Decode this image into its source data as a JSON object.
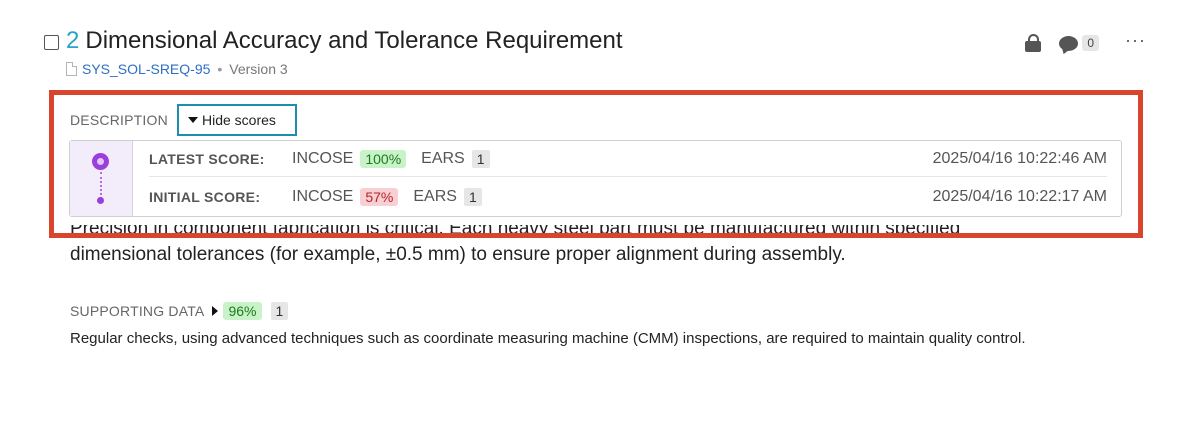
{
  "requirement": {
    "number": "2",
    "title": "Dimensional Accuracy and Tolerance Requirement",
    "id": "SYS_SOL-SREQ-95",
    "separator": "•",
    "version": "Version 3"
  },
  "actions": {
    "lock_icon": "lock-icon",
    "comment_count": "0",
    "more_label": "···"
  },
  "description": {
    "label": "DESCRIPTION",
    "toggle_label": "Hide scores",
    "text_line1": "Precision in component fabrication is critical. Each heavy steel part must be manufactured within specified",
    "text_line2": "dimensional tolerances (for example, ±0.5 mm) to ensure proper alignment during assembly."
  },
  "scores": {
    "latest": {
      "label": "LATEST SCORE:",
      "incose_label": "INCOSE",
      "incose_pct": "100%",
      "ears_label": "EARS",
      "ears_count": "1",
      "timestamp": "2025/04/16 10:22:46 AM"
    },
    "initial": {
      "label": "INITIAL SCORE:",
      "incose_label": "INCOSE",
      "incose_pct": "57%",
      "ears_label": "EARS",
      "ears_count": "1",
      "timestamp": "2025/04/16 10:22:17 AM"
    }
  },
  "supporting": {
    "label": "SUPPORTING DATA",
    "pct": "96%",
    "count": "1",
    "text": "Regular checks, using advanced techniques such as coordinate measuring machine (CMM) inspections, are required to maintain quality control."
  },
  "colors": {
    "highlight": "#d9452c",
    "accent": "#29a3c7",
    "link": "#2f6fc6",
    "good": "#c8f2c8",
    "bad": "#f8cfd2",
    "timeline": "#9b3fdc"
  }
}
